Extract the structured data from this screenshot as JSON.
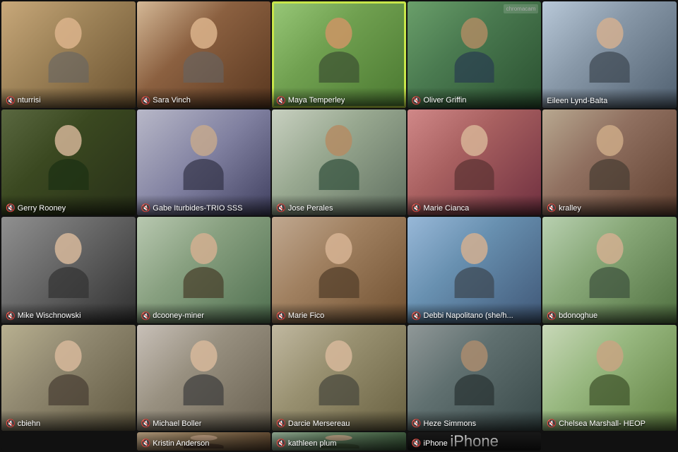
{
  "participants": [
    {
      "id": 1,
      "name": "nturrisi",
      "bg": "p1",
      "row": 1,
      "col": 1,
      "muted": true
    },
    {
      "id": 2,
      "name": "Sara Vinch",
      "bg": "p2",
      "row": 1,
      "col": 2,
      "muted": true
    },
    {
      "id": 3,
      "name": "Maya Temperley",
      "bg": "p3",
      "row": 1,
      "col": 3,
      "muted": true,
      "active": true
    },
    {
      "id": 4,
      "name": "Oliver Griffin",
      "bg": "p4",
      "row": 1,
      "col": 4,
      "muted": true
    },
    {
      "id": 5,
      "name": "Eileen Lynd-Balta",
      "bg": "p5",
      "row": 1,
      "col": 5,
      "muted": false
    },
    {
      "id": 6,
      "name": "Gerry Rooney",
      "bg": "p6",
      "row": 2,
      "col": 1,
      "muted": true
    },
    {
      "id": 7,
      "name": "Gabe Iturbides-TRIO SSS",
      "bg": "p7",
      "row": 2,
      "col": 2,
      "muted": true
    },
    {
      "id": 8,
      "name": "Jose Perales",
      "bg": "p8",
      "row": 2,
      "col": 3,
      "muted": true
    },
    {
      "id": 9,
      "name": "Marie Cianca",
      "bg": "p9",
      "row": 2,
      "col": 4,
      "muted": true
    },
    {
      "id": 10,
      "name": "kralley",
      "bg": "p10",
      "row": 2,
      "col": 5,
      "muted": true
    },
    {
      "id": 11,
      "name": "Mike Wischnowski",
      "bg": "p11",
      "row": 3,
      "col": 1,
      "muted": true
    },
    {
      "id": 12,
      "name": "dcooney-miner",
      "bg": "p12",
      "row": 3,
      "col": 2,
      "muted": true
    },
    {
      "id": 13,
      "name": "Marie Fico",
      "bg": "p13",
      "row": 3,
      "col": 3,
      "muted": true
    },
    {
      "id": 14,
      "name": "Debbi Napolitano (she/h...",
      "bg": "p14",
      "row": 3,
      "col": 4,
      "muted": true
    },
    {
      "id": 15,
      "name": "bdonoghue",
      "bg": "p15",
      "row": 3,
      "col": 5,
      "muted": true
    },
    {
      "id": 16,
      "name": "cbiehn",
      "bg": "p16",
      "row": 4,
      "col": 1,
      "muted": true
    },
    {
      "id": 17,
      "name": "Michael Boller",
      "bg": "p17",
      "row": 4,
      "col": 2,
      "muted": true
    },
    {
      "id": 18,
      "name": "Darcie Mersereau",
      "bg": "p18",
      "row": 4,
      "col": 3,
      "muted": true
    },
    {
      "id": 19,
      "name": "Heze Simmons",
      "bg": "p19",
      "row": 4,
      "col": 4,
      "muted": true
    },
    {
      "id": 20,
      "name": "Chelsea Marshall- HEOP",
      "bg": "p20",
      "row": 4,
      "col": 5,
      "muted": true
    },
    {
      "id": 21,
      "name": "Kristin Anderson",
      "bg": "p21",
      "row": 5,
      "col": 2,
      "muted": true
    },
    {
      "id": 22,
      "name": "kathleen plum",
      "bg": "p22",
      "row": 5,
      "col": 3,
      "muted": true
    },
    {
      "id": 23,
      "name": "iPhone",
      "bg": "iphone",
      "row": 5,
      "col": 4,
      "muted": true
    }
  ],
  "iphone_label": "iPhone",
  "chromacam_label": "chromacam"
}
